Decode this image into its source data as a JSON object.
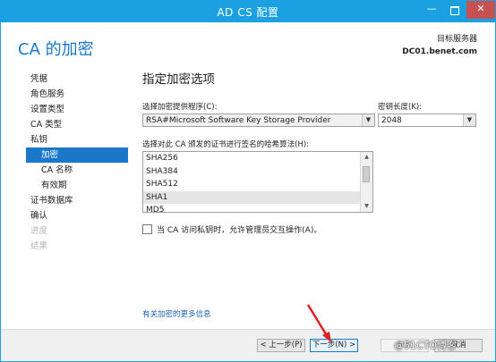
{
  "window": {
    "title": "AD CS 配置"
  },
  "header": {
    "title": "CA 的加密",
    "right_label": "目标服务器",
    "server": "DC01.benet.com"
  },
  "nav": {
    "items": [
      {
        "label": "凭据",
        "state": "normal"
      },
      {
        "label": "角色服务",
        "state": "normal"
      },
      {
        "label": "设置类型",
        "state": "normal"
      },
      {
        "label": "CA 类型",
        "state": "normal"
      },
      {
        "label": "私钥",
        "state": "normal"
      },
      {
        "label": "加密",
        "state": "active"
      },
      {
        "label": "CA 名称",
        "state": "normal"
      },
      {
        "label": "有效期",
        "state": "normal"
      },
      {
        "label": "证书数据库",
        "state": "normal"
      },
      {
        "label": "确认",
        "state": "normal"
      },
      {
        "label": "进度",
        "state": "disabled"
      },
      {
        "label": "结果",
        "state": "disabled"
      }
    ]
  },
  "main": {
    "section_title": "指定加密选项",
    "provider_label": "选择加密提供程序(C):",
    "provider_value": "RSA#Microsoft Software Key Storage Provider",
    "keylength_label": "密钥长度(K):",
    "keylength_value": "2048",
    "hash_label": "选择对此 CA 颁发的证书进行签名的哈希算法(H):",
    "hash_items": [
      "SHA256",
      "SHA384",
      "SHA512",
      "SHA1",
      "MD5"
    ],
    "hash_selected": "SHA1",
    "checkbox_label": "当 CA 访问私钥时，允许管理员交互操作(A)。",
    "link": "有关加密的更多信息"
  },
  "footer": {
    "prev": "< 上一步(P)",
    "next": "下一步(N) >",
    "configure": "配置",
    "cancel": "取消"
  },
  "watermark": "@51CTO博客",
  "colors": {
    "accent": "#1ba1e2",
    "active_nav": "#1a77c9",
    "annotation_arrow": "#e02020"
  }
}
